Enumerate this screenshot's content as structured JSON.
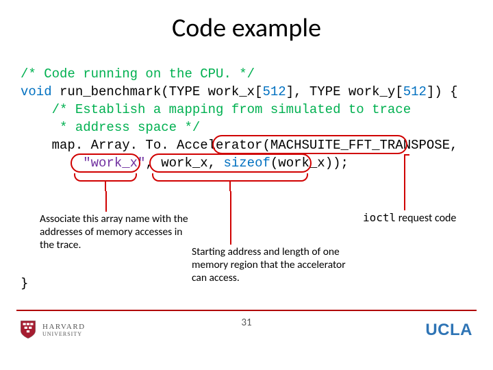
{
  "title": "Code example",
  "code": {
    "c0": "/* Code running on the CPU. */",
    "c1a": "void",
    "c1b": " run_benchmark(TYPE work_x[",
    "c1c": "512",
    "c1d": "], TYPE work_y[",
    "c1e": "512",
    "c1f": "]) {",
    "c2": "    /* Establish a mapping from simulated to trace",
    "c3": "     * address space */",
    "c4a": "    map. Array. To. Accelerator(",
    "c4b": "MACHSUITE_FFT_TRANSPOSE",
    "c4c": ",",
    "c5a": "        ",
    "c5b": "\"work_x\"",
    "c5c": ", work_x, ",
    "c5d": "sizeof",
    "c5e": "(work_x));",
    "close": "}"
  },
  "annotations": {
    "assoc": "Associate this array name with the addresses of memory accesses in the trace.",
    "start": "Starting address and length of one memory region that the accelerator can access.",
    "ioctl_mono": "ioctl",
    "ioctl_rest": " request code"
  },
  "page_number": "31",
  "footer": {
    "harvard": "HARVARD",
    "harvard2": "UNIVERSITY",
    "ucla": "UCLA"
  }
}
